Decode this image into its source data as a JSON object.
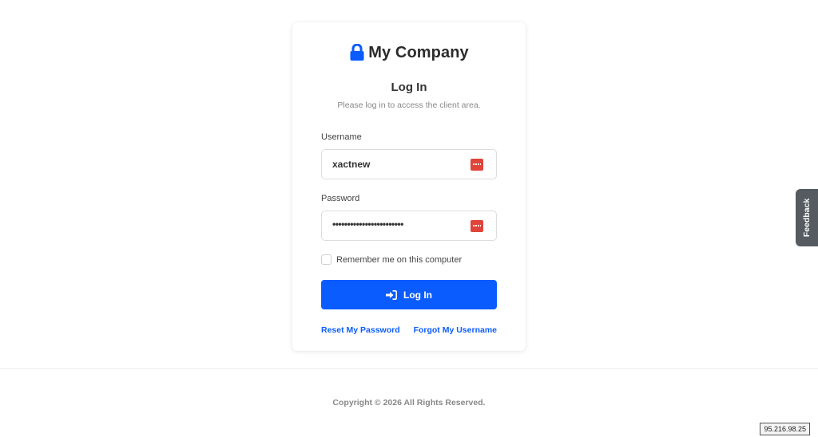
{
  "brand": {
    "name": "My Company",
    "icon": "lock-icon",
    "icon_color": "#0b5cff"
  },
  "login": {
    "title": "Log In",
    "subtitle": "Please log in to access the client area.",
    "username_label": "Username",
    "username_value": "xactnew",
    "password_label": "Password",
    "password_value": "••••••••••••••••••••••••",
    "password_manager_icon": "password-manager-icon",
    "remember_label": "Remember me on this computer",
    "remember_checked": false,
    "button_label": "Log In",
    "button_icon": "sign-in-icon",
    "button_color": "#0b5cff"
  },
  "links": {
    "reset_password": "Reset My Password",
    "forgot_username": "Forgot My Username"
  },
  "footer": {
    "copyright": "Copyright © 2026 All Rights Reserved."
  },
  "feedback": {
    "label": "Feedback"
  },
  "ip_badge": "95.216.98.25"
}
